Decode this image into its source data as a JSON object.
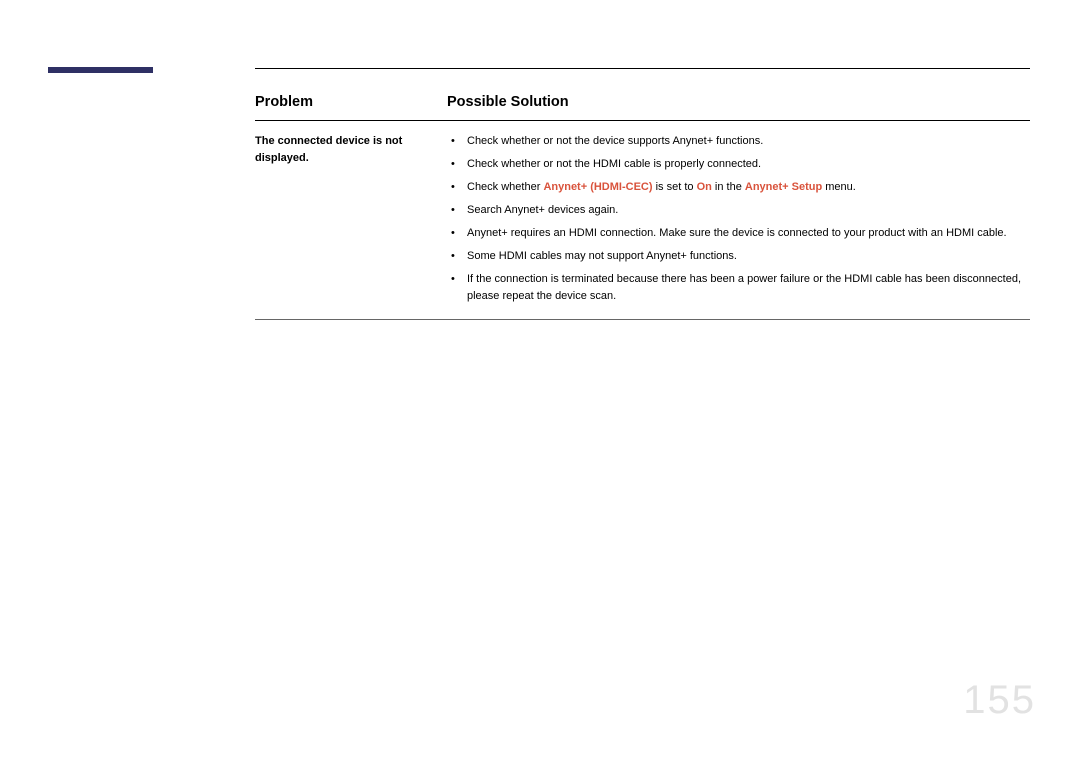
{
  "accent_color": "#2e3064",
  "highlight_color": "#d9533c",
  "page_number": "155",
  "table": {
    "columns": {
      "problem": "Problem",
      "solution": "Possible Solution"
    },
    "row": {
      "problem_text": "The connected device is not displayed.",
      "solutions": {
        "s0": "Check whether or not the device supports Anynet+ functions.",
        "s1": "Check whether or not the HDMI cable is properly connected.",
        "s2_pre": "Check whether ",
        "s2_hl1": "Anynet+ (HDMI-CEC)",
        "s2_mid1": " is set to ",
        "s2_hl2": "On",
        "s2_mid2": " in the ",
        "s2_hl3": "Anynet+ Setup",
        "s2_post": " menu.",
        "s3": "Search Anynet+ devices again.",
        "s4": "Anynet+ requires an HDMI connection. Make sure the device is connected to your product with an HDMI cable.",
        "s5": "Some HDMI cables may not support Anynet+ functions.",
        "s6": "If the connection is terminated because there has been a power failure or the HDMI cable has been disconnected, please repeat the device scan."
      }
    }
  }
}
